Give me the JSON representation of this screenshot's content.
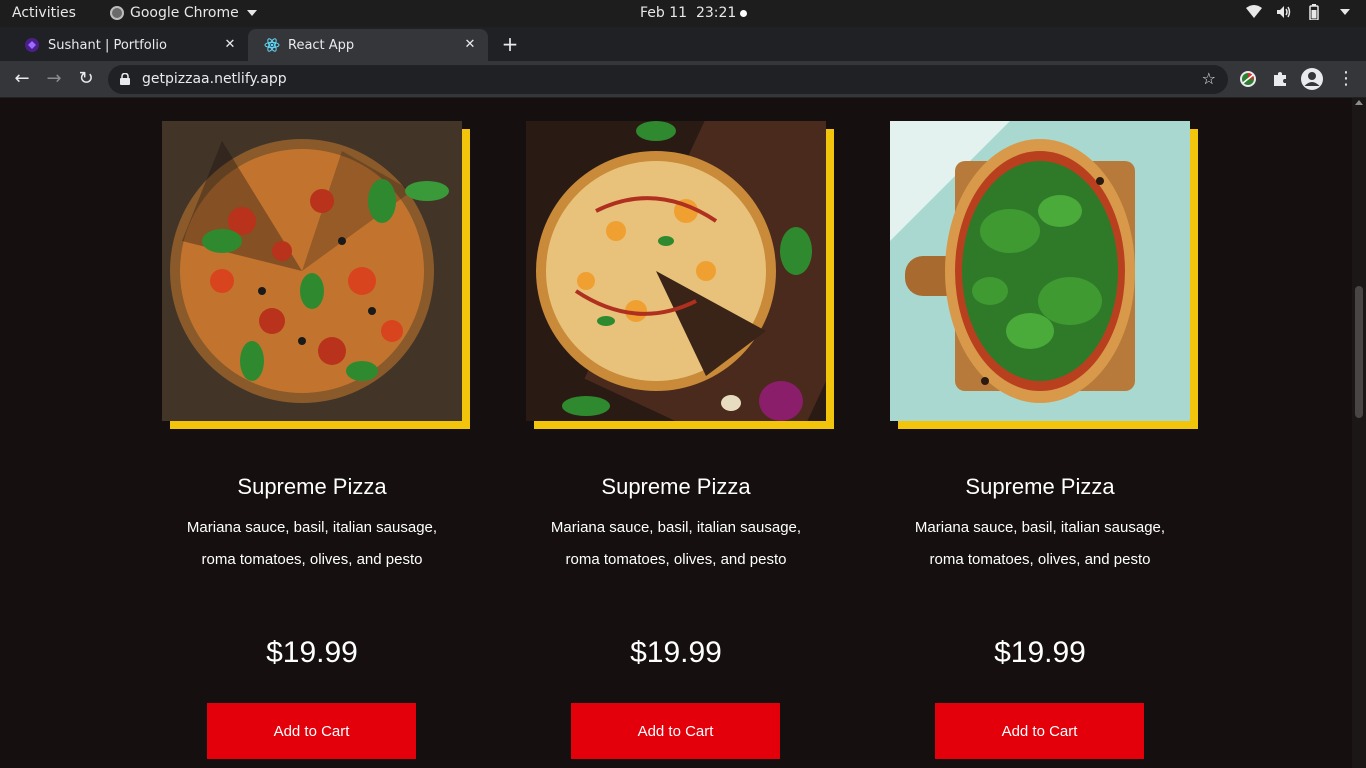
{
  "system_bar": {
    "activities": "Activities",
    "app_name": "Google Chrome",
    "date": "Feb 11",
    "time": "23:21"
  },
  "browser": {
    "tabs": [
      {
        "title": "Sushant | Portfolio",
        "icon": "portfolio-favicon"
      },
      {
        "title": "React App",
        "icon": "react-favicon"
      }
    ],
    "url": "getpizzaa.netlify.app"
  },
  "colors": {
    "accent_yellow": "#f2c40c",
    "button_red": "#e3000b",
    "page_bg": "#150f0f"
  },
  "products": [
    {
      "name": "Supreme Pizza",
      "description": "Mariana sauce, basil, italian sausage, roma tomatoes, olives, and pesto",
      "price": "$19.99",
      "button": "Add to Cart",
      "image": "pepperoni-pizza-photo"
    },
    {
      "name": "Supreme Pizza",
      "description": "Mariana sauce, basil, italian sausage, roma tomatoes, olives, and pesto",
      "price": "$19.99",
      "button": "Add to Cart",
      "image": "chicken-pizza-board-photo"
    },
    {
      "name": "Supreme Pizza",
      "description": "Mariana sauce, basil, italian sausage, roma tomatoes, olives, and pesto",
      "price": "$19.99",
      "button": "Add to Cart",
      "image": "arugula-pizza-photo"
    }
  ]
}
